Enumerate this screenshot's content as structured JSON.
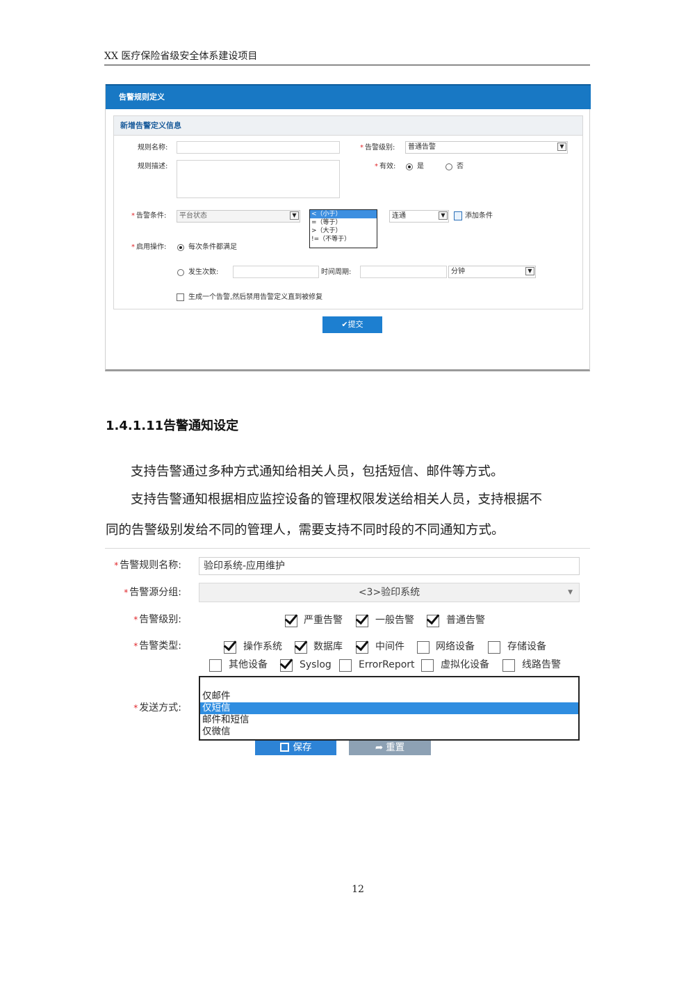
{
  "header": {
    "title": "XX 医疗保险省级安全体系建设项目"
  },
  "screenshot1": {
    "title": "告警规则定义",
    "panel_title": "新增告警定义信息",
    "rule_name_label": "规则名称:",
    "rule_desc_label": "规则描述:",
    "alarm_level_label": "告警级别:",
    "alarm_level_value": "普通告警",
    "valid_label": "有效:",
    "valid_yes": "是",
    "valid_no": "否",
    "condition_label": "告警条件:",
    "condition_value": "平台状态",
    "operators": [
      "<（小于）",
      "=（等于）",
      ">（大于）",
      "!=（不等于）"
    ],
    "condition_state": "连通",
    "add_condition": "添加条件",
    "enable_label": "启用操作:",
    "enable_each": "每次条件都满足",
    "occur_label": "发生次数:",
    "period_label": "时间周期:",
    "period_unit": "分钟",
    "disable_option": "生成一个告警,然后禁用告警定义直到被修复",
    "submit": "提交"
  },
  "section": {
    "title": "1.4.1.11告警通知设定",
    "para1": "支持告警通过多种方式通知给相关人员，包括短信、邮件等方式。",
    "para2_line1": "支持告警通知根据相应监控设备的管理权限发送给相关人员，支持根据不",
    "para2_line2": "同的告警级别发给不同的管理人，需要支持不同时段的不同通知方式。"
  },
  "screenshot2": {
    "rule_name_label": "告警规则名称:",
    "rule_name_value": "验印系统-应用维护",
    "source_group_label": "告警源分组:",
    "source_group_value": "<3>验印系统",
    "level_label": "告警级别:",
    "levels": [
      {
        "label": "严重告警",
        "checked": true
      },
      {
        "label": "一般告警",
        "checked": true
      },
      {
        "label": "普通告警",
        "checked": true
      }
    ],
    "type_label": "告警类型:",
    "types_row1": [
      {
        "label": "操作系统",
        "checked": true
      },
      {
        "label": "数据库",
        "checked": true
      },
      {
        "label": "中间件",
        "checked": true
      },
      {
        "label": "网络设备",
        "checked": false
      },
      {
        "label": "存储设备",
        "checked": false
      }
    ],
    "types_row2": [
      {
        "label": "其他设备",
        "checked": false
      },
      {
        "label": "Syslog",
        "checked": true
      },
      {
        "label": "ErrorReport",
        "checked": false
      },
      {
        "label": "虚拟化设备",
        "checked": false
      },
      {
        "label": "线路告警",
        "checked": false
      }
    ],
    "send_label": "发送方式:",
    "send_options": [
      "仅邮件",
      "仅短信",
      "邮件和短信",
      "仅微信"
    ],
    "send_selected": 1,
    "save": "保存",
    "reset": "重置"
  },
  "footer": {
    "page_number": "12"
  }
}
